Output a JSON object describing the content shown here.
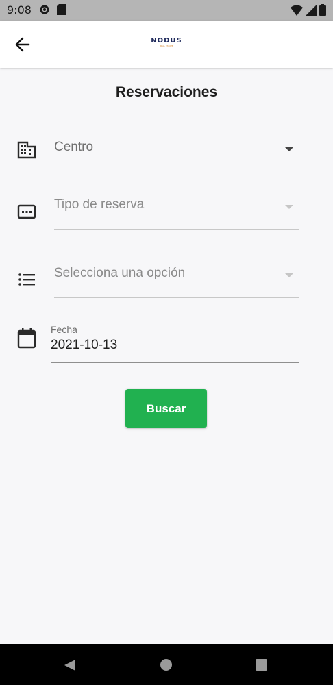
{
  "status_bar": {
    "time": "9:08",
    "icons": [
      "gear-icon",
      "sd-card-icon",
      "wifi-icon",
      "signal-icon",
      "battery-icon"
    ]
  },
  "app_bar": {
    "logo_text": "NODUS",
    "logo_subtext": "REAL ESTATE",
    "back_icon": "arrow-left-icon"
  },
  "page": {
    "title": "Reservaciones"
  },
  "form": {
    "centro": {
      "placeholder": "Centro",
      "icon": "building-icon",
      "enabled": true
    },
    "tipo": {
      "placeholder": "Tipo de reserva",
      "icon": "ticket-icon",
      "enabled": false
    },
    "opcion": {
      "placeholder": "Selecciona una opción",
      "icon": "list-icon",
      "enabled": false
    },
    "fecha": {
      "label": "Fecha",
      "value": "2021-10-13",
      "icon": "calendar-icon"
    }
  },
  "actions": {
    "search_label": "Buscar",
    "search_color": "#21b150"
  },
  "nav_bar": {
    "icons": [
      "nav-back-icon",
      "nav-home-icon",
      "nav-recents-icon"
    ]
  }
}
